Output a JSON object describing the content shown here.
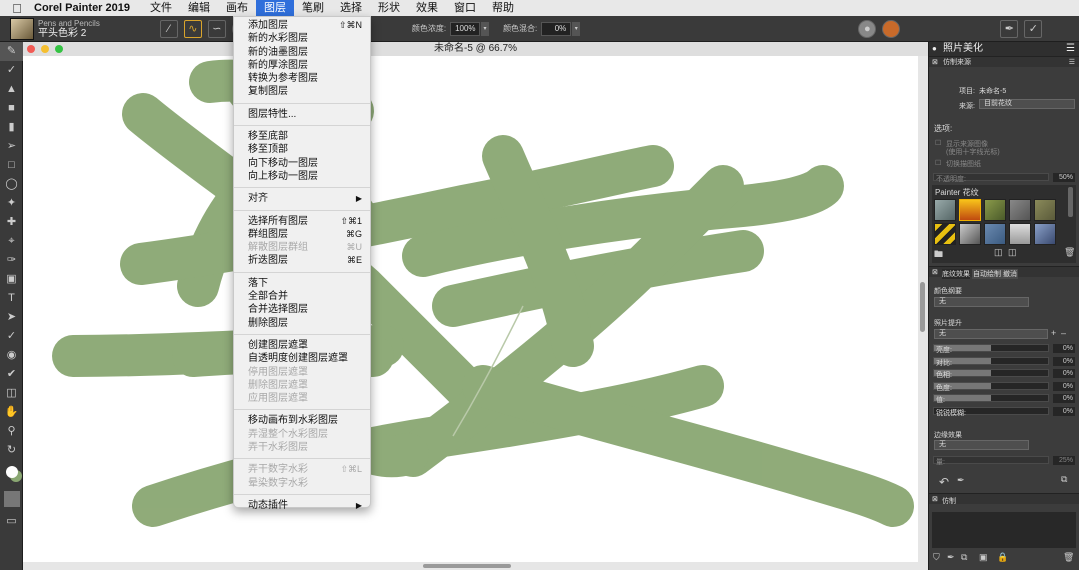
{
  "menubar": {
    "app_name": "Corel Painter 2019",
    "items": [
      "文件",
      "编辑",
      "画布",
      "图层",
      "笔刷",
      "选择",
      "形状",
      "效果",
      "窗口",
      "帮助"
    ],
    "active_index": 3
  },
  "property_bar": {
    "brush_category": "Pens and Pencils",
    "brush_variant": "平头色彩 2",
    "color_concentration_label": "颜色浓度:",
    "color_concentration_value": "100%",
    "color_blend_label": "颜色混合:",
    "color_blend_value": "0%"
  },
  "document": {
    "title": "未命名-5 @ 66.7%"
  },
  "layer_menu": {
    "groups": [
      [
        {
          "label": "添加图层",
          "shortcut": "⇧⌘N",
          "enabled": true
        },
        {
          "label": "新的水彩图层",
          "shortcut": "",
          "enabled": true
        },
        {
          "label": "新的油墨图层",
          "shortcut": "",
          "enabled": true
        },
        {
          "label": "新的厚涂图层",
          "shortcut": "",
          "enabled": true
        },
        {
          "label": "转换为参考图层",
          "shortcut": "",
          "enabled": true
        },
        {
          "label": "复制图层",
          "shortcut": "",
          "enabled": true
        }
      ],
      [
        {
          "label": "图层特性...",
          "shortcut": "",
          "enabled": true
        }
      ],
      [
        {
          "label": "移至底部",
          "shortcut": "",
          "enabled": true
        },
        {
          "label": "移至顶部",
          "shortcut": "",
          "enabled": true
        },
        {
          "label": "向下移动一图层",
          "shortcut": "",
          "enabled": true
        },
        {
          "label": "向上移动一图层",
          "shortcut": "",
          "enabled": true
        }
      ],
      [
        {
          "label": "对齐",
          "shortcut": "",
          "enabled": true,
          "submenu": true
        }
      ],
      [
        {
          "label": "选择所有图层",
          "shortcut": "⇧⌘1",
          "enabled": true
        },
        {
          "label": "群组图层",
          "shortcut": "⌘G",
          "enabled": true
        },
        {
          "label": "解散图层群组",
          "shortcut": "⌘U",
          "enabled": false
        },
        {
          "label": "折迭图层",
          "shortcut": "⌘E",
          "enabled": true
        }
      ],
      [
        {
          "label": "落下",
          "shortcut": "",
          "enabled": true
        },
        {
          "label": "全部合并",
          "shortcut": "",
          "enabled": true
        },
        {
          "label": "合并选择图层",
          "shortcut": "",
          "enabled": true
        },
        {
          "label": "删除图层",
          "shortcut": "",
          "enabled": true
        }
      ],
      [
        {
          "label": "创建图层遮罩",
          "shortcut": "",
          "enabled": true
        },
        {
          "label": "自透明度创建图层遮罩",
          "shortcut": "",
          "enabled": true
        },
        {
          "label": "停用图层遮罩",
          "shortcut": "",
          "enabled": false
        },
        {
          "label": "删除图层遮罩",
          "shortcut": "",
          "enabled": false
        },
        {
          "label": "应用图层遮罩",
          "shortcut": "",
          "enabled": false
        }
      ],
      [
        {
          "label": "移动画布到水彩图层",
          "shortcut": "",
          "enabled": true
        },
        {
          "label": "弄湿整个水彩图层",
          "shortcut": "",
          "enabled": false
        },
        {
          "label": "弄干水彩图层",
          "shortcut": "",
          "enabled": false
        }
      ],
      [
        {
          "label": "弄干数字水彩",
          "shortcut": "⇧⌘L",
          "enabled": false
        },
        {
          "label": "晕染数字水彩",
          "shortcut": "",
          "enabled": false
        }
      ],
      [
        {
          "label": "动态插件",
          "shortcut": "",
          "enabled": true,
          "submenu": true
        }
      ]
    ]
  },
  "panel": {
    "title": "照片美化",
    "clone_source_tab": "仿制来源",
    "project_label": "项目:",
    "project_value": "未命名-5",
    "source_label": "来源:",
    "source_value": "目前花纹",
    "options_label": "选项:",
    "show_source_image": "显示来源图像",
    "show_source_hint": "(使用十字线光标)",
    "toggle_tracing_paper": "切换描图纸",
    "opacity_label": "不透明度:",
    "opacity_value": "50%",
    "pattern_library": "Painter 花纹",
    "tab_texture": "底纹效果",
    "tab_autoclone": "自动绘制",
    "tab_restore": "撤消",
    "color_scheme_label": "颜色纲要",
    "color_scheme_value": "无",
    "photo_enhance_label": "照片提升",
    "photo_enhance_value": "无",
    "sliders": [
      {
        "label": "亮度:",
        "value": "0%",
        "level": 0.5
      },
      {
        "label": "对比:",
        "value": "0%",
        "level": 0.5
      },
      {
        "label": "色相:",
        "value": "0%",
        "level": 0.5
      },
      {
        "label": "色度:",
        "value": "0%",
        "level": 0.5
      },
      {
        "label": "值:",
        "value": "0%",
        "level": 0.5
      },
      {
        "label": "锐锐模糊:",
        "value": "0%",
        "level": 0
      }
    ],
    "edge_effect_label": "边缘效果",
    "edge_effect_value": "无",
    "edge_amount_label": "量:",
    "edge_amount_value": "25%",
    "clone_tab": "仿制"
  },
  "colors": {
    "stroke": "#8aa772",
    "menu_highlight": "#2f6fdb",
    "window_close": "#f25b55",
    "window_min": "#f5bf30",
    "window_max": "#34c343"
  }
}
